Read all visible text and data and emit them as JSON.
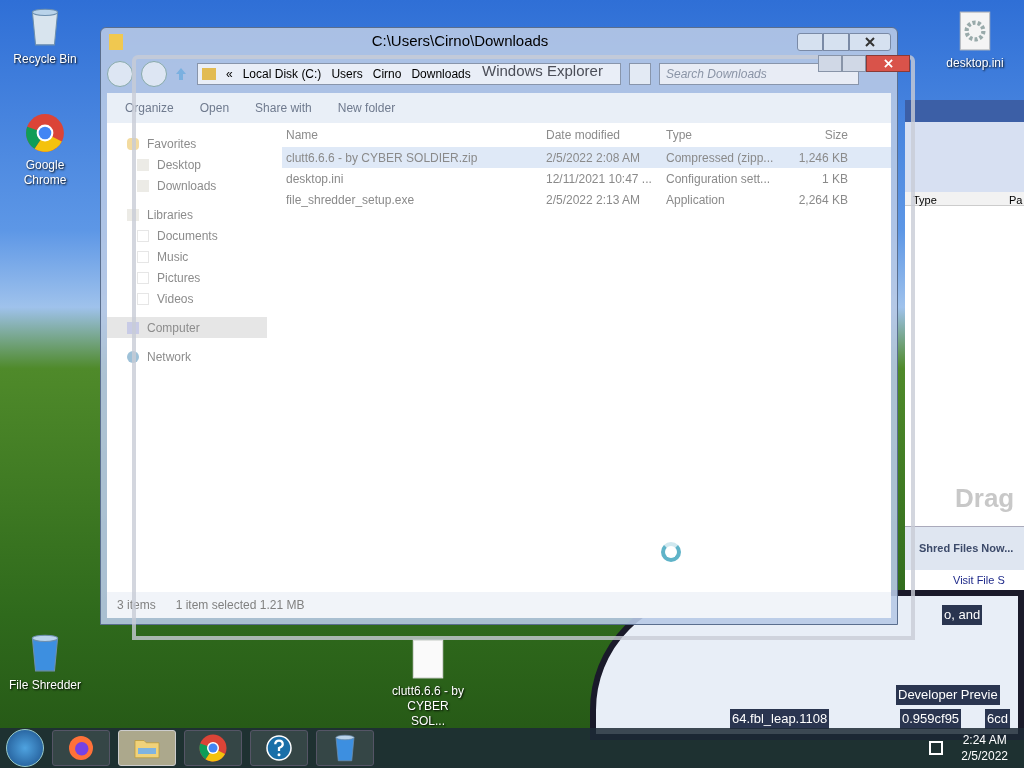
{
  "desktop_icons": [
    {
      "label": "Recycle Bin",
      "kind": "recycle"
    },
    {
      "label": "Google Chrome",
      "kind": "chrome"
    },
    {
      "label": "File Shredder",
      "kind": "shredder"
    },
    {
      "label": "clutt6.6.6 - by CYBER SOL...",
      "kind": "file"
    },
    {
      "label": "desktop.ini",
      "kind": "settings"
    }
  ],
  "wallpaper_texts": [
    "o, and",
    "Developer Previe",
    "64.fbl_leap.1108",
    "0.959cf95",
    "6cd"
  ],
  "explorer": {
    "title": "C:\\Users\\Cirno\\Downloads",
    "ghost_title": "Windows Explorer",
    "breadcrumb": [
      "«",
      "Local Disk (C:)",
      "Users",
      "Cirno",
      "Downloads"
    ],
    "search": {
      "placeholder": "Search Downloads"
    },
    "toolbar": [
      "Organize",
      "Open",
      "Share with",
      "New folder"
    ],
    "nav": [
      {
        "label": "Favorites",
        "kind": "star",
        "children": [
          {
            "label": "Desktop",
            "kind": "folder"
          },
          {
            "label": "Downloads",
            "kind": "folder"
          }
        ]
      },
      {
        "label": "Libraries",
        "kind": "folder",
        "children": [
          {
            "label": "Documents",
            "kind": "doc"
          },
          {
            "label": "Music",
            "kind": "doc"
          },
          {
            "label": "Pictures",
            "kind": "doc"
          },
          {
            "label": "Videos",
            "kind": "doc"
          }
        ]
      },
      {
        "label": "Computer",
        "kind": "computer",
        "selected": true
      },
      {
        "label": "Network",
        "kind": "globe",
        "selected": false
      }
    ],
    "columns": [
      "Name",
      "Date modified",
      "Type",
      "Size"
    ],
    "rows": [
      {
        "cells": [
          "clutt6.6.6 - by CYBER SOLDIER.zip",
          "2/5/2022 2:08 AM",
          "Compressed (zipp...",
          "1,246 KB"
        ],
        "selected": true
      },
      {
        "cells": [
          "desktop.ini",
          "12/11/2021 10:47 ...",
          "Configuration sett...",
          "1 KB"
        ],
        "selected": false
      },
      {
        "cells": [
          "file_shredder_setup.exe",
          "2/5/2022 2:13 AM",
          "Application",
          "2,264 KB"
        ],
        "selected": false
      }
    ],
    "status": [
      "3 items",
      "1 item selected  1.21 MB"
    ]
  },
  "shredder": {
    "columns": [
      "Type",
      "Pa"
    ],
    "drop_hint": "Drag",
    "button": "Shred Files Now...",
    "link": "Visit File S"
  },
  "taskbar": {
    "apps": [
      {
        "kind": "firefox",
        "selected": false
      },
      {
        "kind": "explorer",
        "selected": true
      },
      {
        "kind": "chrome",
        "selected": false
      },
      {
        "kind": "help",
        "selected": false
      },
      {
        "kind": "shredder",
        "selected": false
      }
    ],
    "time": "2:24 AM",
    "date": "2/5/2022"
  }
}
